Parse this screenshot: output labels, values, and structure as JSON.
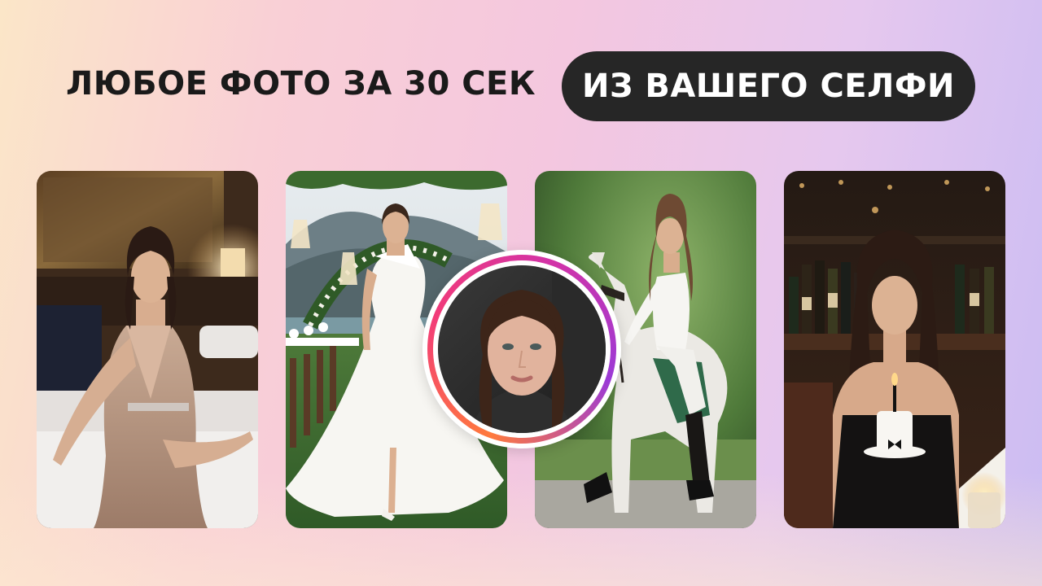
{
  "banner": {
    "headline": "ЛЮБОЕ ФОТО ЗА 30 СЕК",
    "pill_text": "ИЗ ВАШЕГО СЕЛФИ"
  },
  "colors": {
    "pill_background": "#262626",
    "pill_text": "#ffffff",
    "headline_text": "#1a1a1a",
    "selfie_ring_gradient": [
      "#ff7a3d",
      "#f23b78",
      "#d233a8",
      "#9b3ad6"
    ]
  },
  "photos": [
    {
      "name": "photo-woman-in-sequin-gown-on-bed"
    },
    {
      "name": "photo-woman-in-white-wedding-dress-under-floral-arch"
    },
    {
      "name": "photo-woman-riding-white-horse"
    },
    {
      "name": "photo-woman-with-birthday-cake-at-bar"
    }
  ],
  "selfie": {
    "name": "source-selfie-avatar"
  }
}
